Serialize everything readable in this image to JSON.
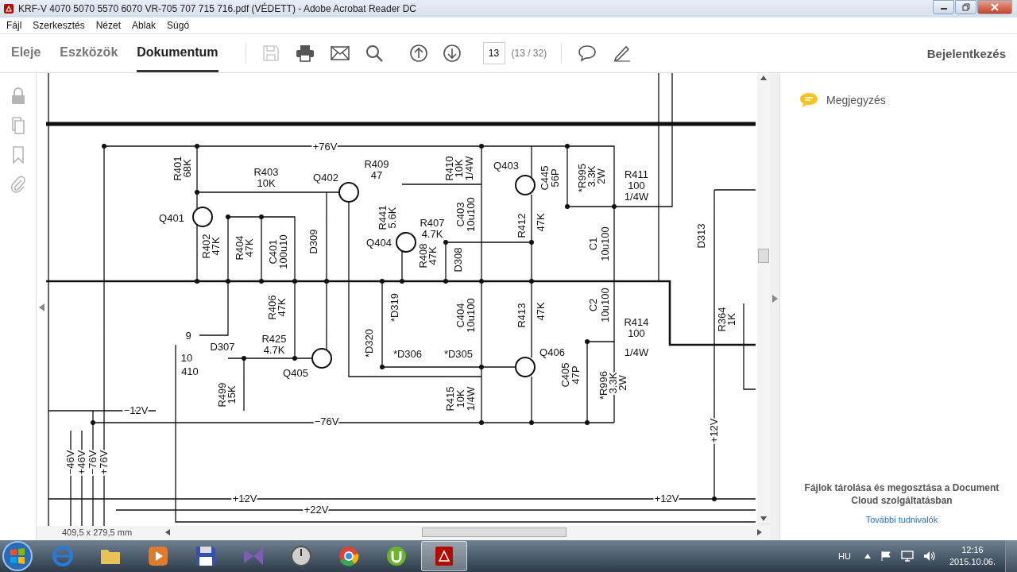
{
  "window": {
    "title": "KRF-V 4070 5070 5570 6070 VR-705 707 715 716.pdf (VÉDETT) - Adobe Acrobat Reader DC"
  },
  "menu": [
    "Fájl",
    "Szerkesztés",
    "Nézet",
    "Ablak",
    "Súgó"
  ],
  "toolbar": {
    "tabs": [
      {
        "label": "Eleje",
        "selected": false
      },
      {
        "label": "Eszközök",
        "selected": false
      },
      {
        "label": "Dokumentum",
        "selected": true
      }
    ],
    "tools": [
      {
        "kind": "save",
        "disabled": true
      },
      {
        "kind": "print",
        "disabled": false
      },
      {
        "kind": "mail",
        "disabled": false
      },
      {
        "kind": "search",
        "disabled": false
      },
      {
        "kind": "up",
        "disabled": false
      },
      {
        "kind": "down",
        "disabled": false
      }
    ],
    "page_field": {
      "value": "13"
    },
    "page_count": "(13 / 32)",
    "tools_right": [
      {
        "kind": "comment"
      },
      {
        "kind": "pen"
      }
    ],
    "sign_in": "Bejelentkezés"
  },
  "left_rail": [
    {
      "kind": "lock"
    },
    {
      "kind": "copy"
    },
    {
      "kind": "bookmark"
    },
    {
      "kind": "attachment"
    }
  ],
  "schematic": {
    "labels": [
      "+76V",
      "R401",
      "68K",
      "R403",
      "10K",
      "Q402",
      "R409",
      "47",
      "R410",
      "10K",
      "1/4W",
      "Q403",
      "C445",
      "56P",
      "*R995",
      "3.3K",
      "2W",
      "R411",
      "100",
      "1/4W",
      "R441",
      "5.6K",
      "C403",
      "10u100",
      "Q401",
      "R407",
      "4.7K",
      "R412",
      "47K",
      "D309",
      "Q404",
      "C1",
      "10u100",
      "D313",
      "R402",
      "47K",
      "R404",
      "47K",
      "C401",
      "100u10",
      "R408",
      "47K",
      "D308",
      "R406",
      "47K",
      "*D319",
      "C404",
      "10u100",
      "R413",
      "47K",
      "C2",
      "10u100",
      "R364",
      "1K",
      "R414",
      "100",
      "1/4W",
      "9",
      "R425",
      "4.7K",
      "*D320",
      "10",
      "D307",
      "*D306",
      "*D305",
      "Q406",
      "Q405",
      "410",
      "R499",
      "15K",
      "C405",
      "47P",
      "*R996",
      "3.3K",
      "2W",
      "−12V",
      "R415",
      "10K",
      "1/4W",
      "−76V",
      "−46V",
      "+46V",
      "−76V",
      "+76V",
      "+12V",
      "+12V",
      "+12V",
      "+22V"
    ]
  },
  "status_bar": {
    "page_size": "409,5 x 279,5 mm"
  },
  "right_panel": {
    "comment_label": "Megjegyzés",
    "promo_text": "Fájlok tárolása és megosztása a Document Cloud szolgáltatásban",
    "promo_link": "További tudnivalók"
  },
  "taskbar": {
    "apps": [
      {
        "kind": "ie",
        "selected": false
      },
      {
        "kind": "folder",
        "selected": false
      },
      {
        "kind": "media",
        "selected": false
      },
      {
        "kind": "save",
        "selected": false
      },
      {
        "kind": "vs",
        "selected": false
      },
      {
        "kind": "gauge",
        "selected": false
      },
      {
        "kind": "chrome",
        "selected": false
      },
      {
        "kind": "torrent",
        "selected": false
      },
      {
        "kind": "acrobat",
        "selected": true
      }
    ],
    "language": "HU",
    "time": "12:16",
    "date": "2015.10.06."
  }
}
